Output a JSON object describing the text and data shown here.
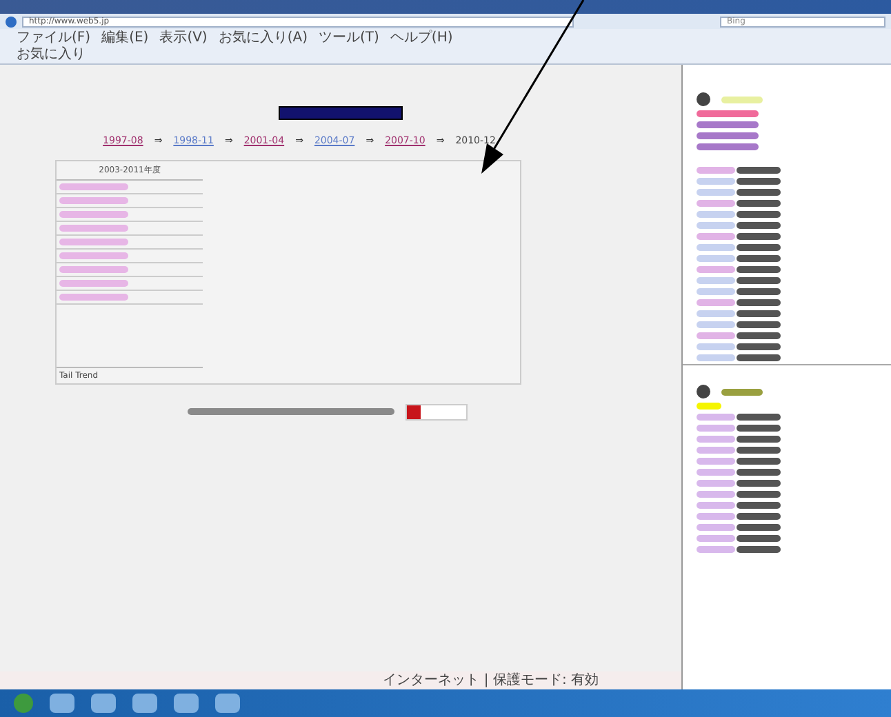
{
  "browser": {
    "address": "http://www.web5.jp",
    "search_placeholder": "Bing",
    "menu": [
      "ファイル(F)",
      "編集(E)",
      "表示(V)",
      "お気に入り(A)",
      "ツール(T)",
      "ヘルプ(H)"
    ],
    "favorites": "お気に入り"
  },
  "timeline": [
    {
      "label": "1997-08",
      "visited": true
    },
    {
      "label": "1998-11",
      "visited": false
    },
    {
      "label": "2001-04",
      "visited": true
    },
    {
      "label": "2004-07",
      "visited": false
    },
    {
      "label": "2007-10",
      "visited": true
    },
    {
      "label": "2010-12",
      "visited": false
    }
  ],
  "separator": "⇒",
  "table": {
    "heading": "2003-2011年度",
    "footer": "Tail Trend"
  },
  "status_bar": {
    "zone": "インターネット | 保護モード: 有効"
  }
}
